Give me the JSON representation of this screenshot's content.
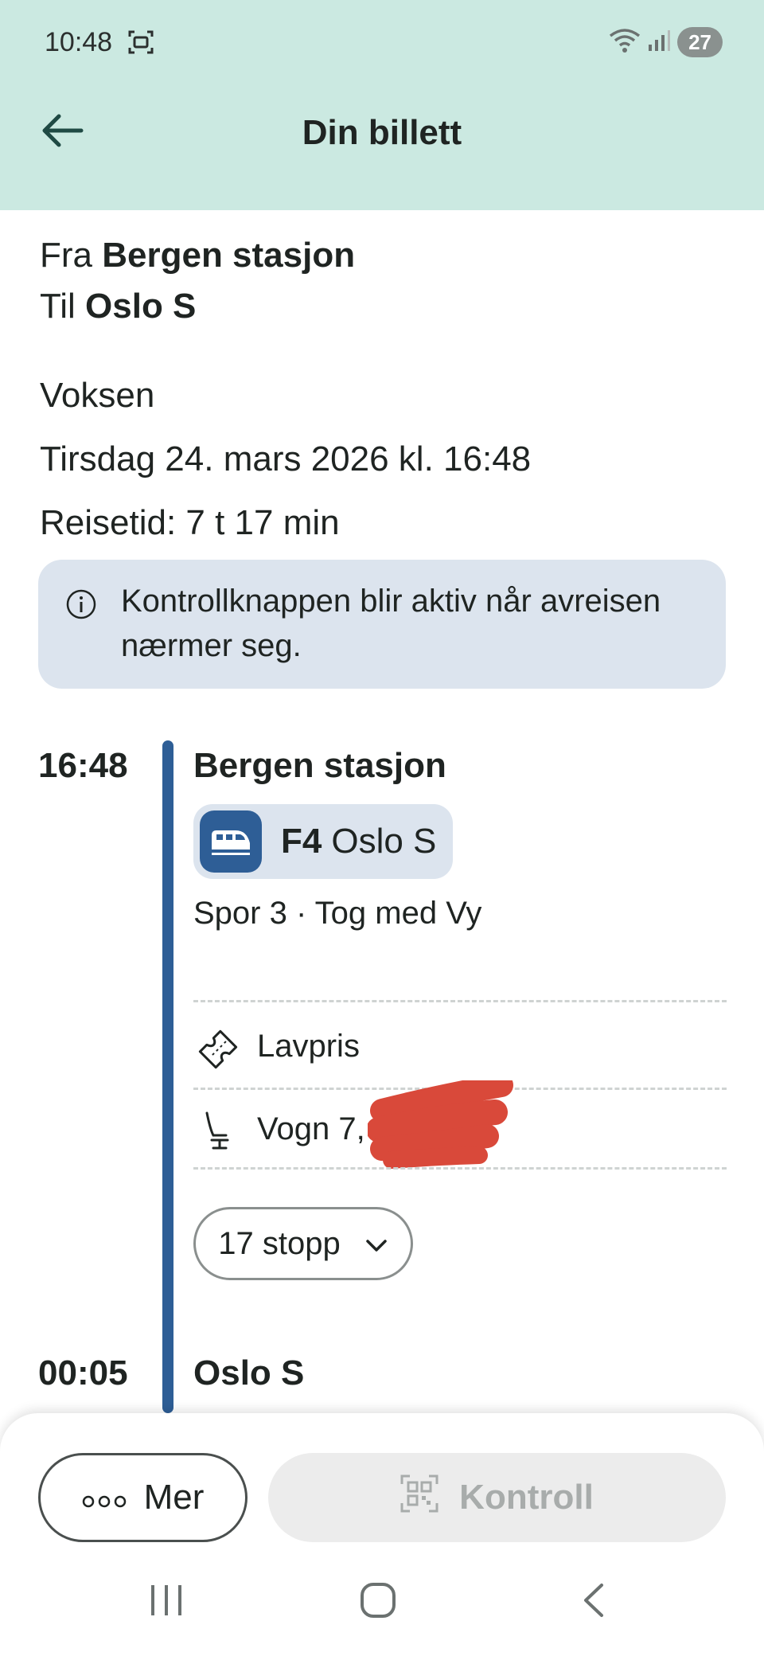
{
  "status_bar": {
    "time": "10:48",
    "battery": "27",
    "icons": [
      "screen-record-icon",
      "wifi-icon",
      "signal-icon",
      "battery-icon"
    ]
  },
  "header": {
    "title": "Din billett",
    "back_icon": "arrow-left-icon"
  },
  "trip": {
    "from_prefix": "Fra",
    "from": "Bergen stasjon",
    "to_prefix": "Til",
    "to": "Oslo S",
    "traveler": "Voksen",
    "date_time": "Tirsdag 24. mars 2026 kl. 16:48",
    "duration": "Reisetid: 7 t 17 min"
  },
  "notice": {
    "icon": "info-icon",
    "text": "Kontrollknappen blir aktiv når avreisen nærmer seg."
  },
  "journey": {
    "departure_time": "16:48",
    "departure_stop": "Bergen stasjon",
    "line_number": "F4",
    "line_destination": "Oslo S",
    "platform_info": "Spor 3 · Tog med Vy",
    "fare": "Lavpris",
    "seat": "Vogn 7,",
    "stops_button": "17 stopp",
    "arrival_time": "00:05",
    "arrival_stop": "Oslo S"
  },
  "actions": {
    "more": "Mer",
    "control": "Kontroll"
  },
  "colors": {
    "header_bg": "#cbe9e1",
    "accent_blue": "#2e5e96",
    "info_bg": "#dce4ee",
    "disabled_text": "#a8acab"
  }
}
